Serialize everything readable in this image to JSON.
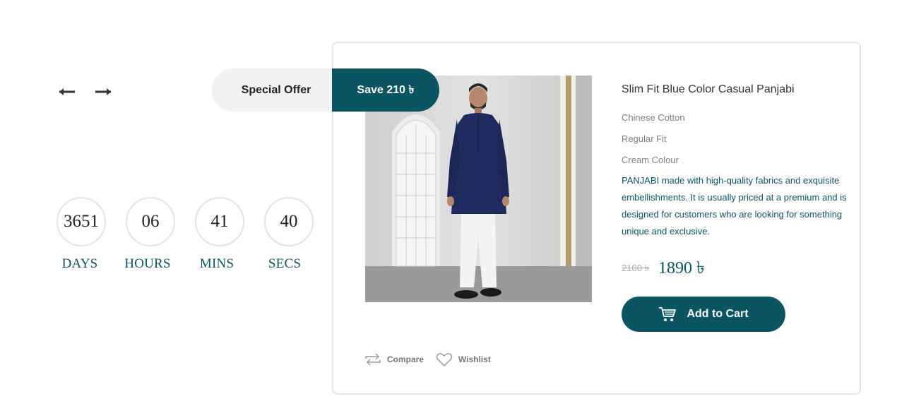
{
  "countdown": [
    {
      "value": "3651",
      "label": "DAYS"
    },
    {
      "value": "06",
      "label": "HOURS"
    },
    {
      "value": "41",
      "label": "MINS"
    },
    {
      "value": "40",
      "label": "SECS"
    }
  ],
  "offer": {
    "label": "Special Offer",
    "save": "Save 210 ৳"
  },
  "product": {
    "title": "Slim Fit Blue Color Casual Panjabi",
    "specs": [
      "Chinese Cotton",
      "Regular Fit",
      "Cream Colour"
    ],
    "description": "PANJABI made with high-quality fabrics and exquisite embellishments. It is usually priced at a premium and is designed for customers who are looking for something unique and exclusive.",
    "old_price": "2100 ৳",
    "new_price": "1890 ৳"
  },
  "actions": {
    "add_to_cart": "Add to Cart",
    "compare": "Compare",
    "wishlist": "Wishlist"
  },
  "icons": {
    "prev": "arrow-left-icon",
    "next": "arrow-right-icon",
    "cart": "cart-icon",
    "compare": "compare-arrows-icon",
    "wishlist": "heart-icon"
  },
  "colors": {
    "accent": "#0b5563",
    "pill_background": "#f1f1f1",
    "card_border": "#e6e6e6",
    "muted_text": "#808080"
  }
}
